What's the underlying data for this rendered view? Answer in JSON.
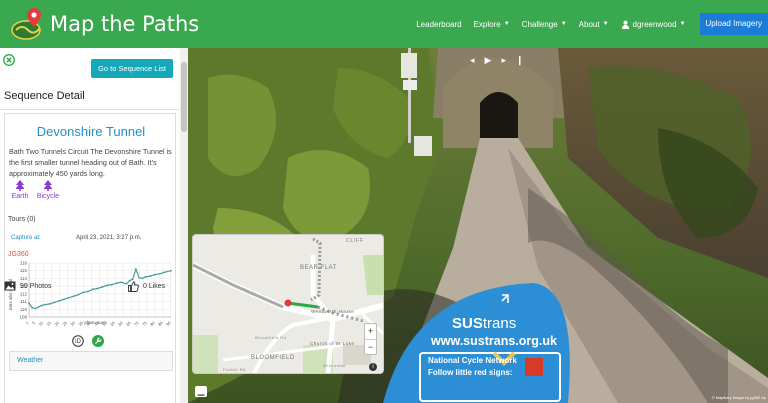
{
  "header": {
    "brand": "Map the Paths",
    "nav": {
      "leaderboard": "Leaderboard",
      "explore": "Explore",
      "challenge": "Challenge",
      "about": "About",
      "user": "dgreenwood",
      "upload": "Upload Imagery"
    }
  },
  "sidebar": {
    "sequence_list_button": "Go to Sequence List",
    "heading": "Sequence Detail",
    "title": "Devonshire Tunnel",
    "description": "Bath Two Tunnels Circuit The Devonshire Tunnel is the first smaller tunnel heading out of Bath. It's approximately 450 yards long.",
    "tags": [
      "Earth",
      "Bicycle"
    ],
    "tours": "Tours (0)",
    "capture_label": "Capture at:",
    "capture_value": "April 23, 2021, 3:27 p.m.",
    "camera": "JG360",
    "chart_ylabel": "mtrs abv sea lvl",
    "chart_xlabel": "photo num",
    "weather": "Weather",
    "photos": "90 Photos",
    "likes": "0 Likes"
  },
  "chart_data": {
    "type": "line",
    "ylabel": "mtrs abv sea lvl",
    "xlabel": "photo num",
    "ylim": [
      109,
      116
    ],
    "yticks": [
      109,
      110,
      111,
      112,
      113,
      114,
      115,
      116
    ],
    "xticks": [
      "1",
      "5",
      "10",
      "15",
      "20",
      "25",
      "30",
      "35",
      "40",
      "45",
      "50",
      "55",
      "60",
      "65",
      "70",
      "75",
      "80",
      "85",
      "90"
    ],
    "x": [
      1,
      3,
      5,
      7,
      9,
      11,
      14,
      17,
      20,
      23,
      26,
      29,
      32,
      35,
      38,
      41,
      44,
      47,
      50,
      53,
      56,
      59,
      62,
      64,
      66,
      68,
      70,
      72,
      74,
      77,
      80,
      83,
      86,
      90
    ],
    "y": [
      110.8,
      110.2,
      110.1,
      110.3,
      110.5,
      110.6,
      110.7,
      110.9,
      111.1,
      111.3,
      111.5,
      111.7,
      111.9,
      112.2,
      112.3,
      112.6,
      112.7,
      112.9,
      113.1,
      113.2,
      113.4,
      113.5,
      113.3,
      113.7,
      113.9,
      115.2,
      114.1,
      114.0,
      114.2,
      114.3,
      114.5,
      114.6,
      114.8,
      115.0
    ],
    "grid": true,
    "color": "#4a9a9a"
  },
  "viewer": {
    "player_controls": [
      "◂",
      "▶",
      "▸",
      "❙"
    ],
    "map_labels": [
      "CLIFF",
      "BEAR FLAT",
      "Wentworth House",
      "Church of St Luke",
      "BLOOMFIELD",
      "Bloomfield Rd",
      "Widcombe",
      "Foxhill Rd"
    ],
    "zoom_in": "+",
    "zoom_out": "−",
    "info": "i",
    "attribution": "© Mapillary   Image by jg360 Ap",
    "sign": {
      "brand_a": "SUS",
      "brand_b": "trans",
      "url": "www.sustrans.org.uk",
      "line1": "National Cycle Network",
      "line2": "Follow little red signs:"
    }
  },
  "colors": {
    "header": "#3aa84f",
    "upload": "#1a7bd9",
    "accent": "#1c92c7",
    "button": "#15a8b8",
    "tag": "#8e3ad0"
  }
}
